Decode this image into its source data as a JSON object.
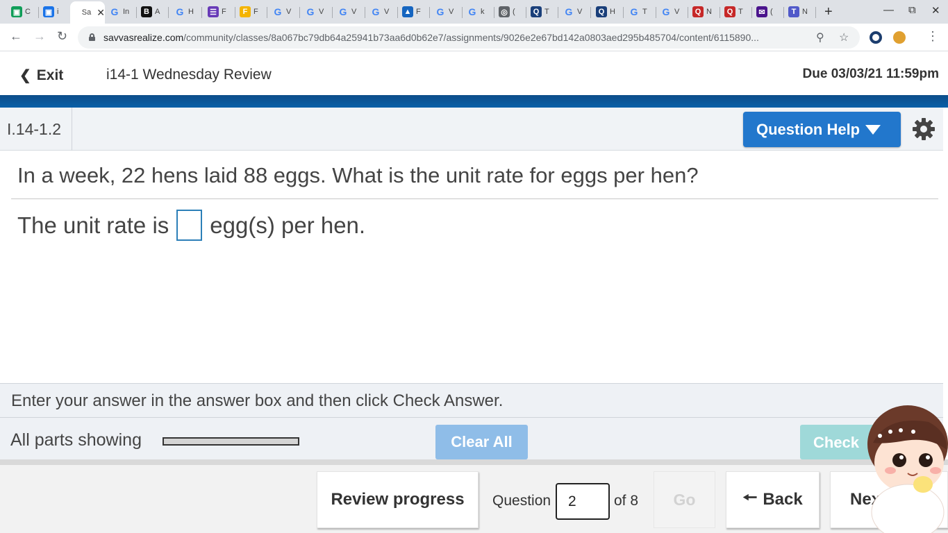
{
  "browser": {
    "tabs": [
      {
        "label": "C",
        "favicon": "#0f9d58",
        "glyph": "▣"
      },
      {
        "label": "i",
        "favicon": "#1a73e8",
        "glyph": "▣"
      },
      {
        "label": "Sa",
        "favicon": "#ffffff",
        "glyph": "",
        "active": true
      },
      {
        "label": "In",
        "favicon": "g",
        "glyph": "G"
      },
      {
        "label": "A",
        "favicon": "#111111",
        "glyph": "B"
      },
      {
        "label": "H",
        "favicon": "g",
        "glyph": "G"
      },
      {
        "label": "F",
        "favicon": "#673ab7",
        "glyph": "☰"
      },
      {
        "label": "F",
        "favicon": "#f4b400",
        "glyph": "F"
      },
      {
        "label": "V",
        "favicon": "g",
        "glyph": "G"
      },
      {
        "label": "V",
        "favicon": "g",
        "glyph": "G"
      },
      {
        "label": "V",
        "favicon": "g",
        "glyph": "G"
      },
      {
        "label": "V",
        "favicon": "g",
        "glyph": "G"
      },
      {
        "label": "F",
        "favicon": "#1565c0",
        "glyph": "▲"
      },
      {
        "label": "V",
        "favicon": "g",
        "glyph": "G"
      },
      {
        "label": "k",
        "favicon": "g",
        "glyph": "G"
      },
      {
        "label": "(",
        "favicon": "#5f6368",
        "glyph": "◎"
      },
      {
        "label": "T",
        "favicon": "#1a3f7a",
        "glyph": "Q"
      },
      {
        "label": "V",
        "favicon": "g",
        "glyph": "G"
      },
      {
        "label": "H",
        "favicon": "#1a3f7a",
        "glyph": "Q"
      },
      {
        "label": "T",
        "favicon": "g",
        "glyph": "G"
      },
      {
        "label": "V",
        "favicon": "g",
        "glyph": "G"
      },
      {
        "label": "N",
        "favicon": "#c62828",
        "glyph": "Q"
      },
      {
        "label": "T",
        "favicon": "#c62828",
        "glyph": "Q"
      },
      {
        "label": "(",
        "favicon": "#4a148c",
        "glyph": "✉"
      },
      {
        "label": "N",
        "favicon": "#5059c9",
        "glyph": "T"
      }
    ],
    "new_tab": "+",
    "url_host": "savvasrealize.com",
    "url_path": "/community/classes/8a067bc79db64a25941b73aa6d0b62e7/assignments/9026e2e67bd142a0803aed295b485704/content/6115890...",
    "icons": {
      "back": "back-arrow-icon",
      "forward": "forward-arrow-icon",
      "reload": "reload-icon",
      "zoom": "zoom-icon",
      "star": "bookmark-star-icon"
    }
  },
  "header": {
    "exit_label": "Exit",
    "assignment_title": "i14-1 Wednesday Review",
    "due_text": "Due 03/03/21 11:59pm"
  },
  "question": {
    "id": "I.14-1.2",
    "help_label": "Question Help",
    "prompt": "In a week, 22 hens laid 88 eggs. What is the unit rate for eggs per hen?",
    "answer_prefix": "The unit rate is",
    "answer_suffix": "egg(s) per hen."
  },
  "instructions": "Enter your answer in the answer box and then click Check Answer.",
  "parts": {
    "label": "All parts showing",
    "progress_fraction": 0.0,
    "clear_label": "Clear All",
    "check_label": "Check"
  },
  "footer": {
    "review_label": "Review progress",
    "question_label": "Question",
    "question_number": "2",
    "of_label": "of 8",
    "go_label": "Go",
    "back_label": "Back",
    "next_label": "Next"
  },
  "colors": {
    "brand_blue": "#2277cc",
    "header_bar": "#0a5fa8",
    "answer_border": "#2c7fb8"
  }
}
